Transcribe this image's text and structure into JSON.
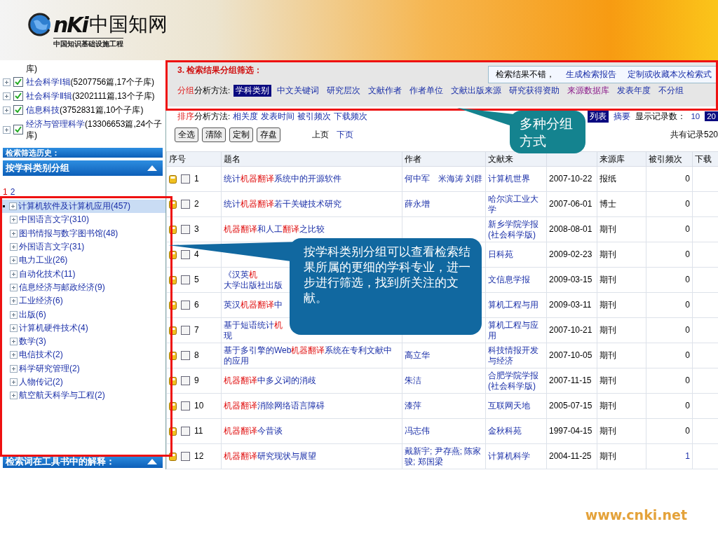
{
  "banner": {
    "logo_mark": "nKi",
    "logo_name": "中国知网",
    "logo_tagline": "中国知识基础设施工程"
  },
  "sidebar": {
    "cut_tail": "库)",
    "databases": [
      {
        "name": "社会科学Ⅰ辑",
        "count": "(5207756篇,17个子库)",
        "checked": true
      },
      {
        "name": "社会科学Ⅱ辑",
        "count": "(3202111篇,13个子库)",
        "checked": true
      },
      {
        "name": "信息科技",
        "count": "(3752831篇,10个子库)",
        "checked": true
      },
      {
        "name": "经济与管理科学",
        "count": "(13306653篇,24个子库)",
        "checked": true
      }
    ],
    "history_title": "检索筛选历史：",
    "subject_title": "按学科类别分组",
    "pages": [
      {
        "label": "1",
        "selected": true
      },
      {
        "label": "2",
        "selected": false
      }
    ],
    "subjects": [
      {
        "label": "计算机软件及计算机应用(457)",
        "selected": true
      },
      {
        "label": "中国语言文字(310)",
        "selected": false
      },
      {
        "label": "图书情报与数字图书馆(48)",
        "selected": false
      },
      {
        "label": "外国语言文字(31)",
        "selected": false
      },
      {
        "label": "电力工业(26)",
        "selected": false
      },
      {
        "label": "自动化技术(11)",
        "selected": false
      },
      {
        "label": "信息经济与邮政经济(9)",
        "selected": false
      },
      {
        "label": "工业经济(6)",
        "selected": false
      },
      {
        "label": "出版(6)",
        "selected": false
      },
      {
        "label": "计算机硬件技术(4)",
        "selected": false
      },
      {
        "label": "数学(3)",
        "selected": false
      },
      {
        "label": "电信技术(2)",
        "selected": false
      },
      {
        "label": "科学研究管理(2)",
        "selected": false
      },
      {
        "label": "人物传记(2)",
        "selected": false
      },
      {
        "label": "航空航天科学与工程(2)",
        "selected": false
      }
    ],
    "toolbook_title": "检索词在工具书中的解释："
  },
  "group_filter": {
    "title": "3. 检索结果分组筛选：",
    "report_text": "检索结果不错，",
    "report_links": [
      "生成检索报告",
      "定制或收藏本次检索式"
    ],
    "label_hit": "分组",
    "label": "分析方法:",
    "options": [
      {
        "label": "学科类别",
        "selected": true,
        "visited": false
      },
      {
        "label": "中文关键词",
        "selected": false,
        "visited": false
      },
      {
        "label": "研究层次",
        "selected": false,
        "visited": false
      },
      {
        "label": "文献作者",
        "selected": false,
        "visited": false
      },
      {
        "label": "作者单位",
        "selected": false,
        "visited": false
      },
      {
        "label": "文献出版来源",
        "selected": false,
        "visited": false
      },
      {
        "label": "研究获得资助",
        "selected": false,
        "visited": false
      },
      {
        "label": "来源数据库",
        "selected": false,
        "visited": true
      },
      {
        "label": "发表年度",
        "selected": false,
        "visited": false
      },
      {
        "label": "不分组",
        "selected": false,
        "visited": false
      }
    ]
  },
  "sort": {
    "label_hit": "排序",
    "label": "分析方法:",
    "options": [
      "相关度",
      "发表时间",
      "被引频次",
      "下载频次"
    ],
    "views": [
      {
        "label": "列表",
        "selected": true
      },
      {
        "label": "摘要",
        "selected": false
      }
    ],
    "count_label": "显示记录数：",
    "counts": [
      {
        "label": "10",
        "selected": false
      },
      {
        "label": "20",
        "selected": true
      }
    ]
  },
  "actions": [
    "全选",
    "清除",
    "定制",
    "存盘"
  ],
  "pager": [
    {
      "label": "上页",
      "disabled": true
    },
    {
      "label": "下页",
      "disabled": false
    }
  ],
  "total": "共有记录520",
  "columns": [
    "序号",
    "题名",
    "作者",
    "文献来"
  ],
  "columns_after_date": [
    "来源库",
    "被引频次",
    "下载"
  ],
  "rows": [
    {
      "no": "1",
      "checked": false,
      "title": [
        [
          {
            "t": "统计",
            "hit": false
          },
          {
            "t": "机器翻译",
            "hit": true
          },
          {
            "t": "系统中的开源软件",
            "hit": false
          }
        ]
      ],
      "author": "何中军　米海涛 刘群",
      "source": "计算机世界",
      "date": "2007-10-22",
      "db": "报纸",
      "cited": "0",
      "cited_link": false
    },
    {
      "no": "2",
      "checked": false,
      "title": [
        [
          {
            "t": "统计",
            "hit": false
          },
          {
            "t": "机器翻译",
            "hit": true
          },
          {
            "t": "若干关键技术研究",
            "hit": false
          }
        ]
      ],
      "author": "薛永增",
      "source": "哈尔滨工业大学",
      "date": "2007-06-01",
      "db": "博士",
      "cited": "0",
      "cited_link": false
    },
    {
      "no": "3",
      "checked": false,
      "title": [
        [
          {
            "t": "机器翻译",
            "hit": true
          },
          {
            "t": "和人工",
            "hit": false
          },
          {
            "t": "翻译",
            "hit": true
          },
          {
            "t": "之比较",
            "hit": false
          }
        ]
      ],
      "source": "新乡学院学报(社会科学版)",
      "date": "2008-08-01",
      "db": "期刊",
      "cited": "0",
      "cited_link": false
    },
    {
      "no": "4",
      "checked": false,
      "source": "日科苑",
      "date": "2009-02-23",
      "db": "期刊",
      "cited": "0",
      "cited_link": false
    },
    {
      "no": "5",
      "checked": false,
      "title": [
        [
          {
            "t": "《汉英",
            "hit": false
          },
          {
            "t": "机",
            "hit": true
          }
        ],
        [
          {
            "t": "大学出版社出版",
            "hit": false
          }
        ]
      ],
      "source": "文信息学报",
      "date": "2009-03-15",
      "db": "期刊",
      "cited": "0",
      "cited_link": false
    },
    {
      "no": "6",
      "checked": false,
      "title": [
        [
          {
            "t": "英汉",
            "hit": false
          },
          {
            "t": "机器翻译",
            "hit": true
          },
          {
            "t": "中",
            "hit": false
          }
        ]
      ],
      "source": "算机工程与用",
      "date": "2009-03-11",
      "db": "期刊",
      "cited": "0",
      "cited_link": false
    },
    {
      "no": "7",
      "checked": false,
      "title": [
        [
          {
            "t": "基于短语统计",
            "hit": false
          },
          {
            "t": "机",
            "hit": true
          }
        ],
        [
          {
            "t": "现",
            "hit": false
          }
        ]
      ],
      "source": "算机工程与应用",
      "date": "2007-10-21",
      "db": "期刊",
      "cited": "0",
      "cited_link": false
    },
    {
      "no": "8",
      "checked": false,
      "title": [
        [
          {
            "t": "基于多引擎的Web",
            "hit": false
          },
          {
            "t": "机器翻译",
            "hit": true
          },
          {
            "t": "系统在专利文献中的应用",
            "hit": false
          }
        ]
      ],
      "author": "高立华",
      "source": "科技情报开发与经济",
      "date": "2007-10-05",
      "db": "期刊",
      "cited": "0",
      "cited_link": false
    },
    {
      "no": "9",
      "checked": false,
      "title": [
        [
          {
            "t": "机器翻译",
            "hit": true
          },
          {
            "t": "中多义词的消歧",
            "hit": false
          }
        ]
      ],
      "author": "朱洁",
      "source": "合肥学院学报(社会科学版)",
      "date": "2007-11-15",
      "db": "期刊",
      "cited": "0",
      "cited_link": false
    },
    {
      "no": "10",
      "checked": false,
      "title": [
        [
          {
            "t": "机器翻译",
            "hit": true
          },
          {
            "t": "消除网络语言障碍",
            "hit": false
          }
        ]
      ],
      "author": "漆萍",
      "source": "互联网天地",
      "date": "2005-07-15",
      "db": "期刊",
      "cited": "0",
      "cited_link": false
    },
    {
      "no": "11",
      "checked": false,
      "title": [
        [
          {
            "t": "机器翻译",
            "hit": true
          },
          {
            "t": "今昔谈",
            "hit": false
          }
        ]
      ],
      "author": "冯志伟",
      "source": "金秋科苑",
      "date": "1997-04-15",
      "db": "期刊",
      "cited": "0",
      "cited_link": false
    },
    {
      "no": "12",
      "checked": false,
      "title": [
        [
          {
            "t": "机器翻译",
            "hit": true
          },
          {
            "t": "研究现状与展望",
            "hit": false
          }
        ]
      ],
      "author": "戴新宇; 尹存燕; 陈家骏; 郑国梁",
      "source": "计算机科学",
      "date": "2004-11-25",
      "db": "期刊",
      "cited": "1",
      "cited_link": true
    }
  ],
  "callouts": [
    {
      "kind": "teal",
      "text": "多种分组方式"
    },
    {
      "kind": "blue",
      "text": "按学科类别分组可以查看检索结果所属的更细的学科专业，进一步进行筛选，找到所关注的文献。"
    }
  ],
  "footer": "www.cnki.net"
}
